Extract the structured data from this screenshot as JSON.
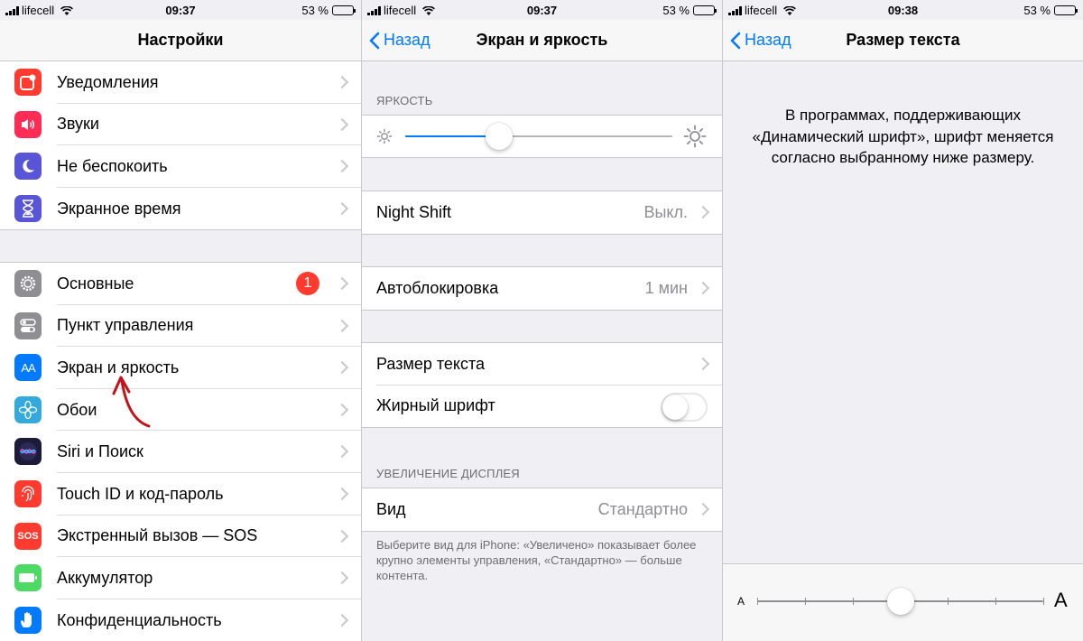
{
  "status_bars": [
    {
      "carrier": "lifecell",
      "time": "09:37",
      "battery": "53 %",
      "battery_level": 0.53
    },
    {
      "carrier": "lifecell",
      "time": "09:37",
      "battery": "53 %",
      "battery_level": 0.53
    },
    {
      "carrier": "lifecell",
      "time": "09:38",
      "battery": "53 %",
      "battery_level": 0.53
    }
  ],
  "screen1": {
    "title": "Настройки",
    "group1": [
      {
        "label": "Уведомления",
        "icon": "notifications-icon",
        "color": "#ff3b30"
      },
      {
        "label": "Звуки",
        "icon": "sounds-icon",
        "color": "#ff2d55"
      },
      {
        "label": "Не беспокоить",
        "icon": "moon-icon",
        "color": "#5856d6"
      },
      {
        "label": "Экранное время",
        "icon": "hourglass-icon",
        "color": "#5856d6"
      }
    ],
    "group2": [
      {
        "label": "Основные",
        "icon": "gear-icon",
        "color": "#8e8e93",
        "badge": "1"
      },
      {
        "label": "Пункт управления",
        "icon": "toggles-icon",
        "color": "#8e8e93"
      },
      {
        "label": "Экран и яркость",
        "icon": "display-icon",
        "color": "#007aff",
        "glyph": "AA"
      },
      {
        "label": "Обои",
        "icon": "wallpaper-icon",
        "color": "#34aadc"
      },
      {
        "label": "Siri и Поиск",
        "icon": "siri-icon",
        "color": "#1c1c3a"
      },
      {
        "label": "Touch ID и код-пароль",
        "icon": "fingerprint-icon",
        "color": "#ff3b30"
      },
      {
        "label": "Экстренный вызов — SOS",
        "icon": "sos-icon",
        "color": "#ff3b30",
        "glyph": "SOS"
      },
      {
        "label": "Аккумулятор",
        "icon": "battery-icon",
        "color": "#4cd964"
      },
      {
        "label": "Конфиденциальность",
        "icon": "hand-icon",
        "color": "#007aff"
      }
    ]
  },
  "screen2": {
    "back": "Назад",
    "title": "Экран и яркость",
    "brightness_header": "ЯРКОСТЬ",
    "brightness_level": 0.35,
    "night_shift": {
      "label": "Night Shift",
      "value": "Выкл."
    },
    "autolock": {
      "label": "Автоблокировка",
      "value": "1 мин"
    },
    "text_size": {
      "label": "Размер текста"
    },
    "bold_text": {
      "label": "Жирный шрифт",
      "on": false
    },
    "zoom_header": "УВЕЛИЧЕНИЕ ДИСПЛЕЯ",
    "view": {
      "label": "Вид",
      "value": "Стандартно"
    },
    "footer": "Выберите вид для iPhone: «Увеличено» показывает более крупно элементы управления, «Стандартно» — больше контента."
  },
  "screen3": {
    "back": "Назад",
    "title": "Размер текста",
    "description": "В программах, поддерживающих «Динамический шрифт», шрифт меняется согласно выбранному ниже размеру.",
    "small_a": "A",
    "large_a": "A",
    "text_size_step": 3,
    "text_size_steps": 7
  },
  "colors": {
    "accent": "#007aff",
    "annotation": "#c4121a"
  }
}
